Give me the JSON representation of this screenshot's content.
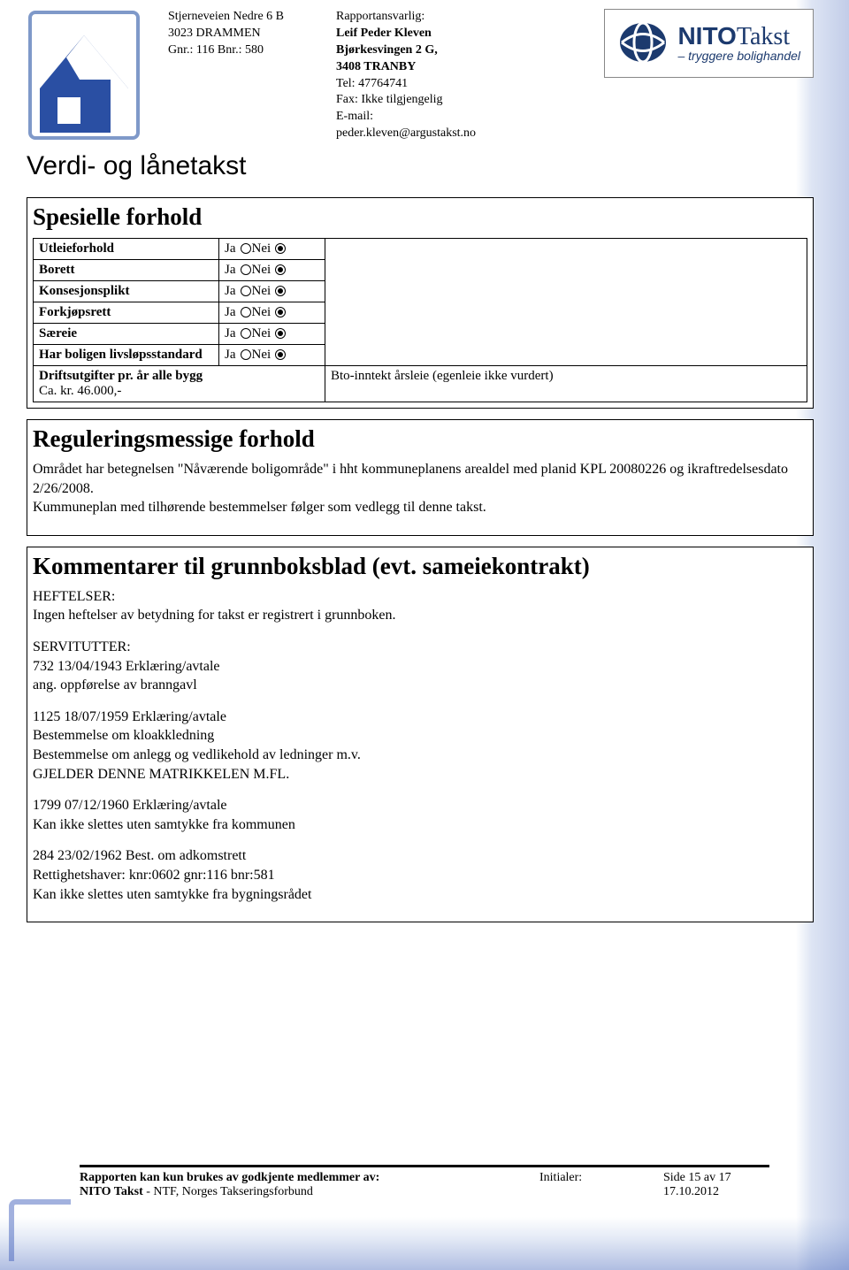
{
  "header": {
    "address": {
      "line1": "Stjerneveien Nedre 6 B",
      "line2": "3023 DRAMMEN",
      "line3": "Gnr.: 116 Bnr.: 580"
    },
    "responsible": {
      "label": "Rapportansvarlig:",
      "name": "Leif Peder Kleven",
      "addr1": "Bjørkesvingen 2 G,",
      "addr2": "3408 TRANBY",
      "tel": "Tel: 47764741",
      "fax": "Fax: Ikke tilgjengelig",
      "email_label": "E-mail:",
      "email": "peder.kleven@argustakst.no"
    },
    "brand": {
      "name1": "NITO",
      "name2": "Takst",
      "tag": "– tryggere bolighandel"
    }
  },
  "doc_title": "Verdi- og lånetakst",
  "sections": {
    "spesielle": {
      "title": "Spesielle forhold",
      "rows": [
        {
          "label": "Utleieforhold",
          "ja": "Ja",
          "nei": "Nei",
          "selected": "nei"
        },
        {
          "label": "Borett",
          "ja": "Ja",
          "nei": "Nei",
          "selected": "nei"
        },
        {
          "label": "Konsesjonsplikt",
          "ja": "Ja",
          "nei": "Nei",
          "selected": "nei"
        },
        {
          "label": "Forkjøpsrett",
          "ja": "Ja",
          "nei": "Nei",
          "selected": "nei"
        },
        {
          "label": "Særeie",
          "ja": "Ja",
          "nei": "Nei",
          "selected": "nei"
        },
        {
          "label": "Har boligen livsløpsstandard",
          "ja": "Ja",
          "nei": "Nei",
          "selected": "nei"
        }
      ],
      "drift_label": "Driftsutgifter pr. år alle bygg",
      "drift_value": "Ca. kr. 46.000,-",
      "bto_label": "Bto-inntekt årsleie (egenleie ikke vurdert)"
    },
    "regulering": {
      "title": "Reguleringsmessige forhold",
      "text": "Området har betegnelsen \"Nåværende boligområde\" i hht kommuneplanens arealdel med planid KPL 20080226 og ikraftredelsesdato 2/26/2008.\nKummuneplan med tilhørende bestemmelser følger som vedlegg til denne takst."
    },
    "kommentarer": {
      "title": "Kommentarer til grunnboksblad (evt. sameiekontrakt)",
      "p1": "HEFTELSER:\nIngen heftelser av betydning for takst er registrert i grunnboken.",
      "p2": "SERVITUTTER:\n732 13/04/1943 Erklæring/avtale\nang. oppførelse av branngavl",
      "p3": "1125 18/07/1959 Erklæring/avtale\nBestemmelse om kloakkledning\nBestemmelse om anlegg og vedlikehold av ledninger m.v.\nGJELDER DENNE MATRIKKELEN M.FL.",
      "p4": "1799 07/12/1960 Erklæring/avtale\nKan ikke slettes uten samtykke fra kommunen",
      "p5": "284 23/02/1962 Best. om adkomstrett\nRettighetshaver: knr:0602 gnr:116 bnr:581\nKan ikke slettes uten samtykke fra bygningsrådet"
    }
  },
  "footer": {
    "line1a": "Rapporten kan kun brukes av godkjente medlemmer av:",
    "line2a_bold": "NITO Takst",
    "line2a_rest": " - NTF, Norges Takseringsforbund",
    "initials": "Initialer:",
    "page": "Side 15 av 17",
    "date": "17.10.2012"
  }
}
